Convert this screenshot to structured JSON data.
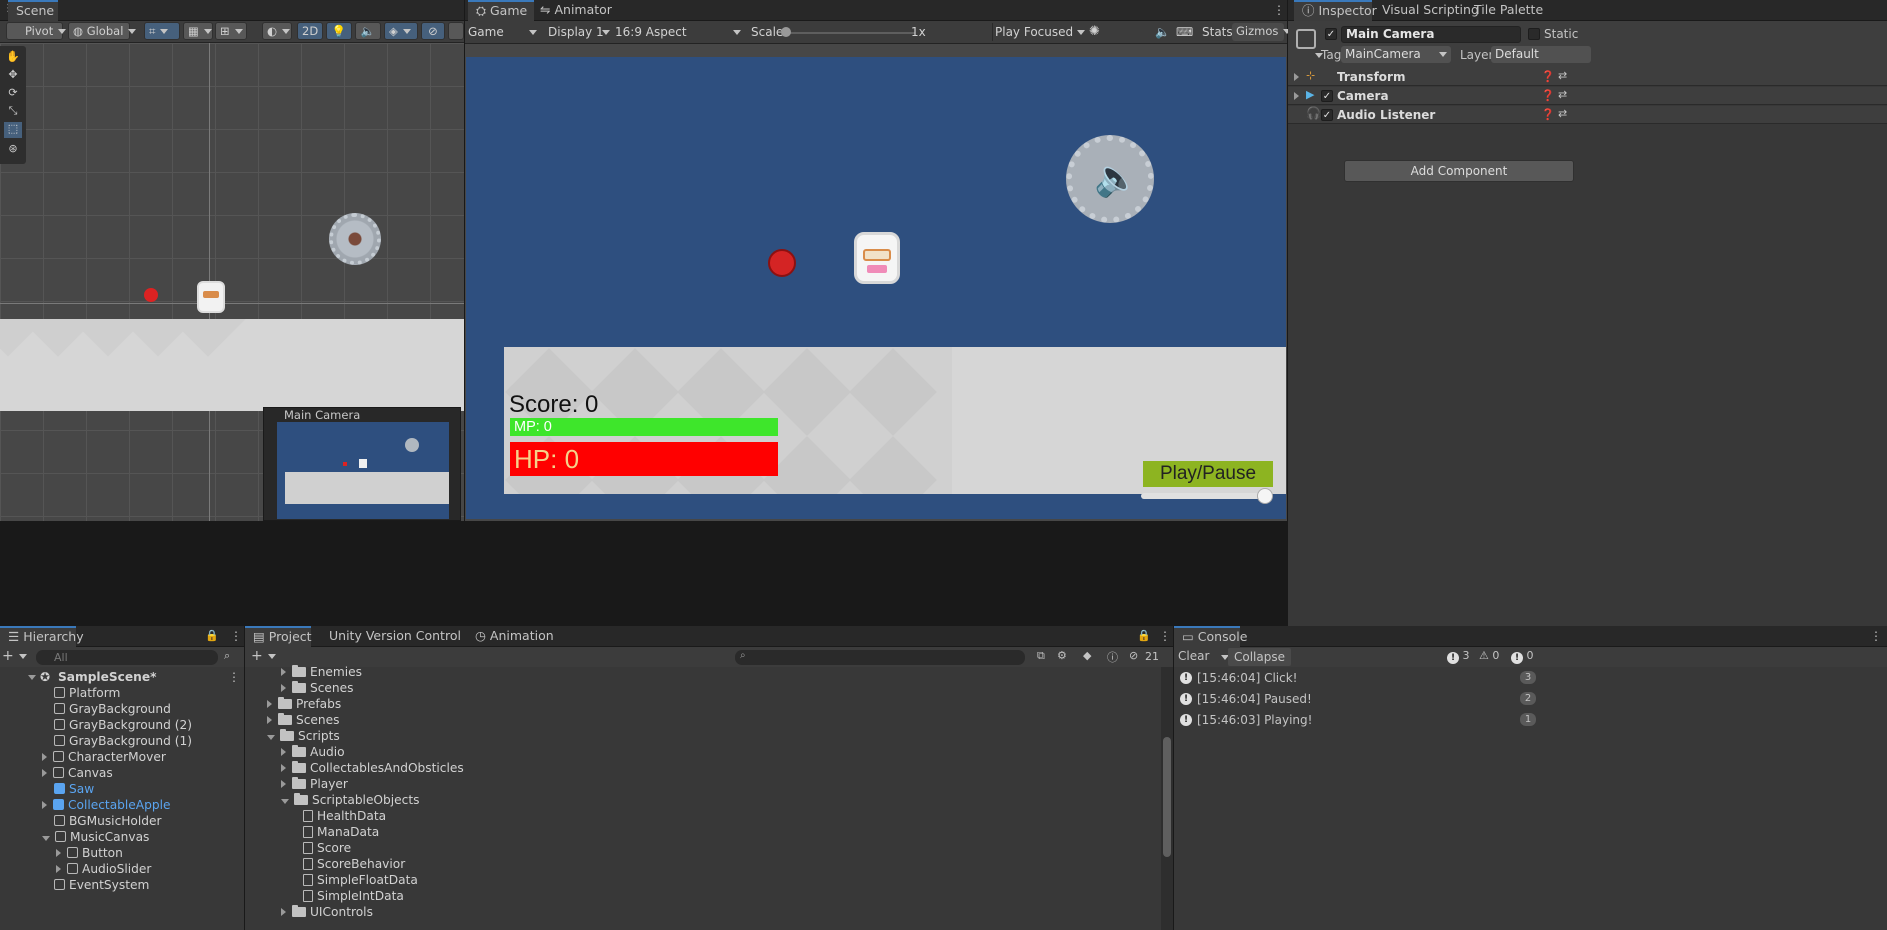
{
  "scene": {
    "tab": "Scene",
    "pivot": "Pivot",
    "global": "Global",
    "mode2d": "2D",
    "camera_preview_title": "Main Camera"
  },
  "game": {
    "tabs": [
      "Game",
      "Animator"
    ],
    "display_mode": "Game",
    "display": "Display 1",
    "aspect": "16:9 Aspect",
    "scale_label": "Scale",
    "scale_value": "1x",
    "play_mode": "Play Focused",
    "stats": "Stats",
    "gizmos": "Gizmos",
    "score_text": "Score: 0",
    "mp_text": "MP: 0",
    "hp_text": "HP: 0",
    "play_pause": "Play/Pause",
    "volume": 0.95,
    "mp_fill": 1.0,
    "hp_fill": 1.0
  },
  "inspector": {
    "tabs": [
      "Inspector",
      "Visual Scripting",
      "Tile Palette"
    ],
    "object_name": "Main Camera",
    "static_label": "Static",
    "tag_label": "Tag",
    "tag_value": "MainCamera",
    "layer_label": "Layer",
    "layer_value": "Default",
    "components": [
      "Transform",
      "Camera",
      "Audio Listener"
    ],
    "add_component": "Add Component"
  },
  "hierarchy": {
    "tab": "Hierarchy",
    "search_placeholder": "All",
    "scene_name": "SampleScene*",
    "items": [
      "Platform",
      "GrayBackground",
      "GrayBackground (2)",
      "GrayBackground (1)",
      "CharacterMover",
      "Canvas",
      "Saw",
      "CollectableApple",
      "BGMusicHolder",
      "MusicCanvas",
      "Button",
      "AudioSlider",
      "EventSystem"
    ]
  },
  "project": {
    "tabs": [
      "Project",
      "Unity Version Control",
      "Animation"
    ],
    "hidden_count": "21",
    "tree": [
      "Enemies",
      "Scenes",
      "Prefabs",
      "Scenes",
      "Scripts",
      "Audio",
      "CollectablesAndObsticles",
      "Player",
      "ScriptableObjects",
      "HealthData",
      "ManaData",
      "Score",
      "ScoreBehavior",
      "SimpleFloatData",
      "SimpleIntData",
      "UIControls"
    ]
  },
  "console": {
    "tab": "Console",
    "clear": "Clear",
    "collapse": "Collapse",
    "info_count": "3",
    "warn_count": "0",
    "error_count": "0",
    "entries": [
      {
        "text": "[15:46:04] Click!",
        "count": "3"
      },
      {
        "text": "[15:46:04] Paused!",
        "count": "2"
      },
      {
        "text": "[15:46:03] Playing!",
        "count": "1"
      }
    ]
  },
  "colors": {
    "accent": "#3a79bb",
    "game_bg": "#2e4f7f",
    "mp_bar": "#3ee62b",
    "hp_bar": "#ff0000",
    "button": "#8db421",
    "selected_text": "#5aa4f0"
  }
}
